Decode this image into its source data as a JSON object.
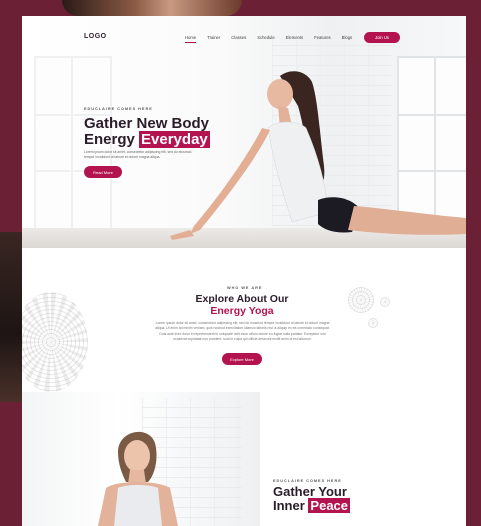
{
  "header": {
    "logo": "LOGO",
    "nav": [
      "Home",
      "Trainer",
      "Classes",
      "Schedule",
      "Elements",
      "Features",
      "Blogs"
    ],
    "join_label": "Join Us"
  },
  "hero": {
    "eyebrow": "EDUCLAIRE COMES HERE",
    "title_line1": "Gather New Body",
    "title_word": "Energy",
    "title_highlight": "Everyday",
    "description": "Lorem ipsum dolor sit amet, consectetur adipiscing elit, sed do eiusmod tempor incididunt ut labore et dolore magna aliqua.",
    "button": "Read More"
  },
  "about": {
    "eyebrow": "WHO WE ARE",
    "title_line1": "Explore About Our",
    "title_line2": "Energy Yoga",
    "description": "Lorem ipsum dolor sit amet, consectetur adipiscing elit, sed do eiusmod tempor incididunt ut labore et dolore magna aliqua. Ut enim ad minim veniam, quis nostrud exercitation ullamco laboris nisi ut aliquip ex ea commodo consequat. Duis aute irure dolor in reprehenderit in voluptate velit esse cillum dolore eu fugiat nulla pariatur. Excepteur sint occaecat cupidatat non proident, sunt in culpa qui officia deserunt mollit anim id est laborum.",
    "button": "Explore More"
  },
  "peace": {
    "eyebrow": "EDUCLAIRE COMES HERE",
    "title_line1": "Gather Your",
    "title_word": "Inner",
    "title_highlight": "Peace"
  },
  "colors": {
    "accent": "#b3144f",
    "frame": "#6b2035",
    "heading": "#2a1c2a"
  }
}
